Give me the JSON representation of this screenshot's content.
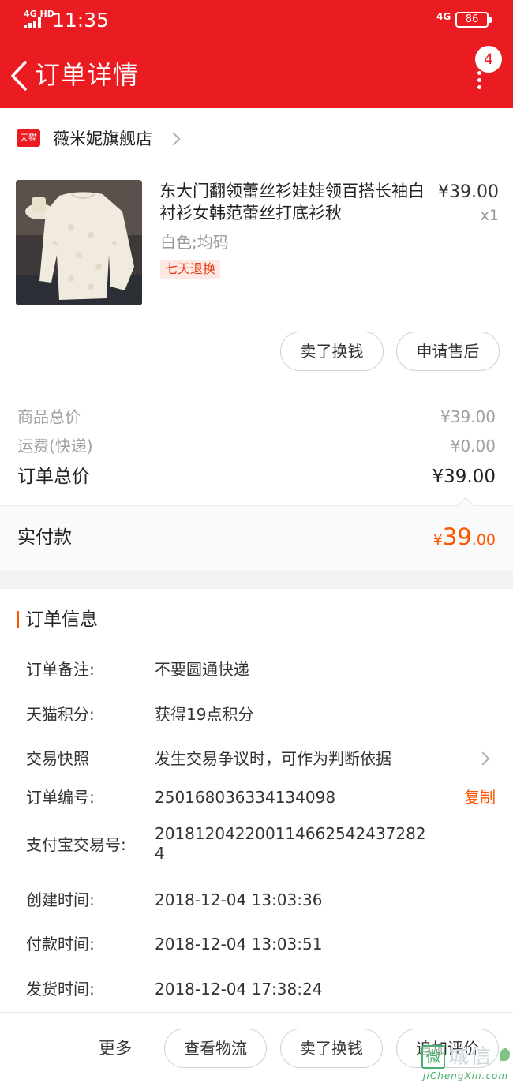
{
  "colors": {
    "brand_red": "#ea1c22",
    "accent_orange": "#ff5500",
    "muted_gray": "#a0a0a0"
  },
  "status_bar": {
    "network": "4G HD",
    "time": "11:35",
    "network_right": "4G",
    "battery": "86"
  },
  "header": {
    "back_icon": "chevron-left-icon",
    "title": "订单详情",
    "notification_count": "4",
    "more_icon": "vertical-dots-icon"
  },
  "shop": {
    "logo_text": "天猫",
    "name": "薇米妮旗舰店"
  },
  "product": {
    "title": "东大门翻领蕾丝衫娃娃领百搭长袖白衬衫女韩范蕾丝打底衫秋",
    "price": "¥39.00",
    "quantity": "x1",
    "sku": "白色;均码",
    "tag": "七天退换"
  },
  "product_actions": {
    "sell_label": "卖了换钱",
    "after_sale_label": "申请售后"
  },
  "summary": {
    "goods_total_label": "商品总价",
    "goods_total_value": "¥39.00",
    "shipping_label": "运费(快递)",
    "shipping_value": "¥0.00",
    "order_total_label": "订单总价",
    "order_total_value": "¥39.00",
    "paid_label": "实付款",
    "paid_currency": "¥",
    "paid_integer": "39",
    "paid_decimal": ".00"
  },
  "order_info": {
    "title": "订单信息",
    "remark_label": "订单备注:",
    "remark_value": "不要圆通快递",
    "points_label": "天猫积分:",
    "points_value": "获得19点积分",
    "snapshot_label": "交易快照",
    "snapshot_value": "发生交易争议时，可作为判断依据",
    "order_no_label": "订单编号:",
    "order_no_value": "250168036334134098",
    "copy_label": "复制",
    "alipay_label": "支付宝交易号:",
    "alipay_value_line1": "20181204220011466254243728​2",
    "alipay_value_line2": "4",
    "created_label": "创建时间:",
    "created_value": "2018-12-04 13:03:36",
    "paid_time_label": "付款时间:",
    "paid_time_value": "2018-12-04 13:03:51",
    "shipped_label": "发货时间:",
    "shipped_value": "2018-12-04 17:38:24"
  },
  "bottom_bar": {
    "more_label": "更多",
    "logistics_label": "查看物流",
    "sell_label": "卖了换钱",
    "review_label": "追加评价"
  },
  "watermark": {
    "cn": "城信",
    "en": "JiChengXin.com"
  }
}
